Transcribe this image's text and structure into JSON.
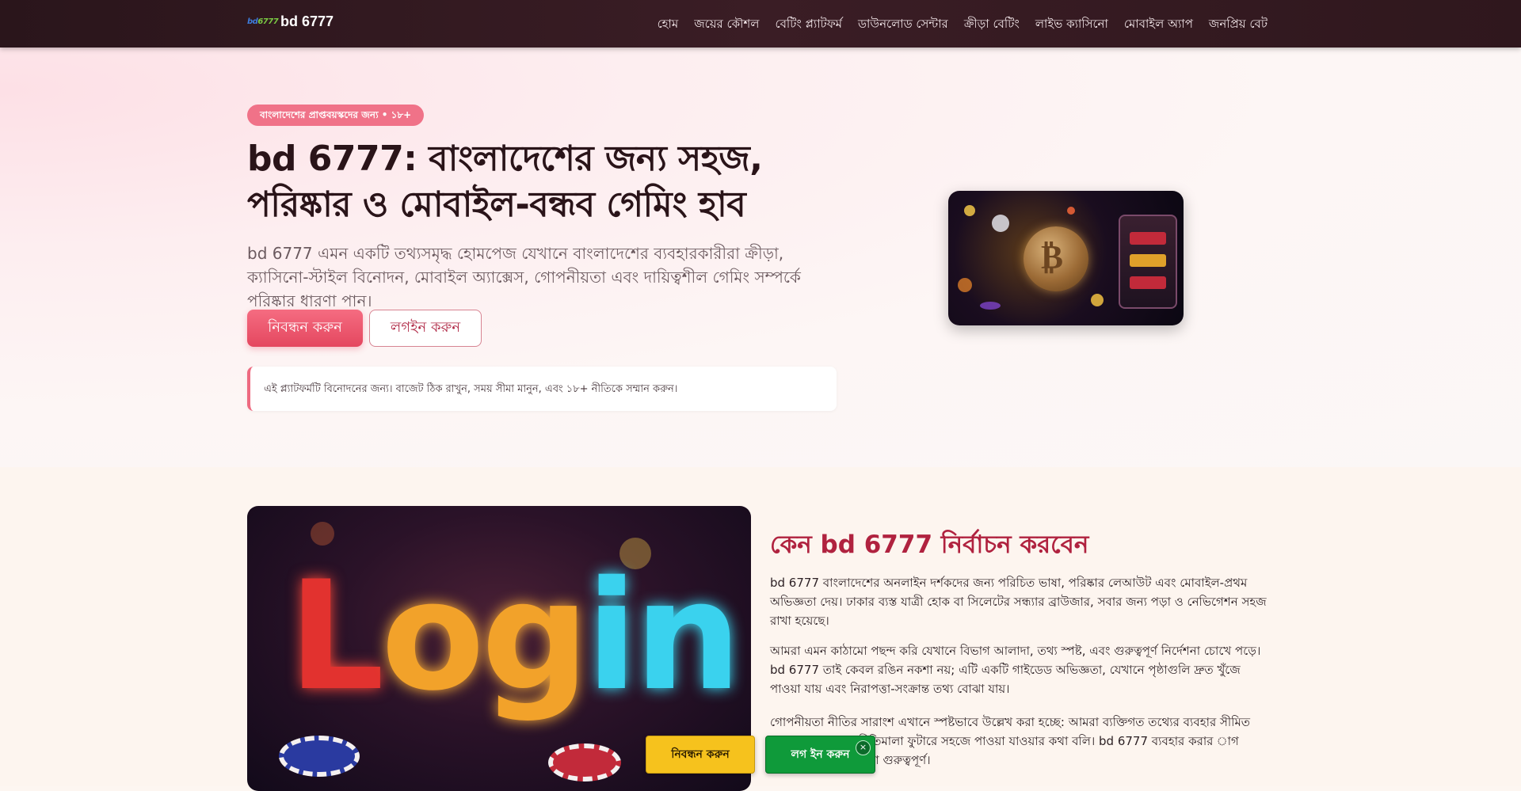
{
  "header": {
    "brand_logo_text": "bd6777",
    "brand_name": "bd 6777",
    "nav": [
      "হোম",
      "জয়ের কৌশল",
      "বেটিং প্ল্যাটফর্ম",
      "ডাউনলোড সেন্টার",
      "ক্রীড়া বেটিং",
      "লাইভ ক্যাসিনো",
      "মোবাইল অ্যাপ",
      "জনপ্রিয় বেট"
    ]
  },
  "hero": {
    "badge": "বাংলাদেশের প্রাপ্তবয়স্কদের জন্য • ১৮+",
    "title": "bd 6777: বাংলাদেশের জন্য সহজ, পরিষ্কার ও মোবাইল-বন্ধব গেমিং হাব",
    "description": "bd 6777 এমন একটি তথ্যসমৃদ্ধ হোমপেজ যেখানে বাংলাদেশের ব্যবহারকারীরা ক্রীড়া, ক্যাসিনো-স্টাইল বিনোদন, মোবাইল অ্যাক্সেস, গোপনীয়তা এবং দায়িত্বশীল গেমিং সম্পর্কে পরিষ্কার ধারণা পান।",
    "register_label": "নিবন্ধন করুন",
    "login_label": "লগইন করুন",
    "notice": "এই প্ল্যাটফর্মটি বিনোদনের জন্য। বাজেট ঠিক রাখুন, সময় সীমা মানুন, এবং ১৮+ নীতিকে সম্মান করুন।",
    "image_icon": "bitcoin-slot-machine-image"
  },
  "why": {
    "title": "কেন bd 6777 নির্বাচন করবেন",
    "paragraphs": [
      "bd 6777 বাংলাদেশের অনলাইন দর্শকদের জন্য পরিচিত ভাষা, পরিষ্কার লেআউট এবং মোবাইল-প্রথম অভিজ্ঞতা দেয়। ঢাকার ব্যস্ত যাত্রী হোক বা সিলেটের সন্ধ্যার ব্রাউজার, সবার জন্য পড়া ও নেভিগেশন সহজ রাখা হয়েছে।",
      "আমরা এমন কাঠামো পছন্দ করি যেখানে বিভাগ আলাদা, তথ্য স্পষ্ট, এবং গুরুত্বপূর্ণ নির্দেশনা চোখে পড়ে। bd 6777 তাই কেবল রঙিন নকশা নয়; এটি একটি গাইডেড অভিজ্ঞতা, যেখানে পৃষ্ঠাগুলি দ্রুত খুঁজে পাওয়া যায় এবং নিরাপত্তা-সংক্রান্ত তথ্য বোঝা যায়।",
      "গোপনীয়তা নীতির সারাংশ এখানে স্পষ্টভাবে উল্লেখ করা হচ্ছে: আমরা ব্যক্তিগত তথ্যের ব্যবহার সীমিত রাখার, করার এবং নীতিমালা ফুটারে সহজে পাওয়া যাওয়ার কথা বলি। bd 6777 ব্যবহার করার াগ করছেন তা বুঝে নেওয়া গুরুত্বপূর্ণ।"
    ],
    "image_text": "Login"
  },
  "sticky_cta": {
    "register_label": "নিবন্ধন করুন",
    "login_label": "লগ ইন করুন",
    "close_label": "×"
  },
  "colors": {
    "header_bg": "#2a151b",
    "accent_pink": "#e4475f",
    "title_red": "#b0223f",
    "cta_yellow": "#f6c21d",
    "cta_green": "#0f9a3a"
  }
}
